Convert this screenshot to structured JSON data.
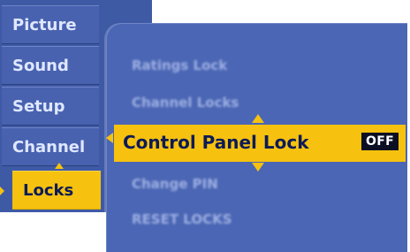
{
  "main_menu": {
    "items": [
      {
        "label": "Picture"
      },
      {
        "label": "Sound"
      },
      {
        "label": "Setup"
      },
      {
        "label": "Channel"
      },
      {
        "label": "Locks"
      }
    ]
  },
  "submenu": {
    "items": [
      {
        "label": "Ratings Lock"
      },
      {
        "label": "Channel Locks"
      },
      {
        "label": "Control Panel Lock",
        "value": "OFF"
      },
      {
        "label": "Change PIN"
      },
      {
        "label": "RESET LOCKS"
      }
    ]
  },
  "colors": {
    "menu_blue": "#4862b0",
    "highlight": "#f6c20f",
    "text_dark": "#0d1b56"
  }
}
